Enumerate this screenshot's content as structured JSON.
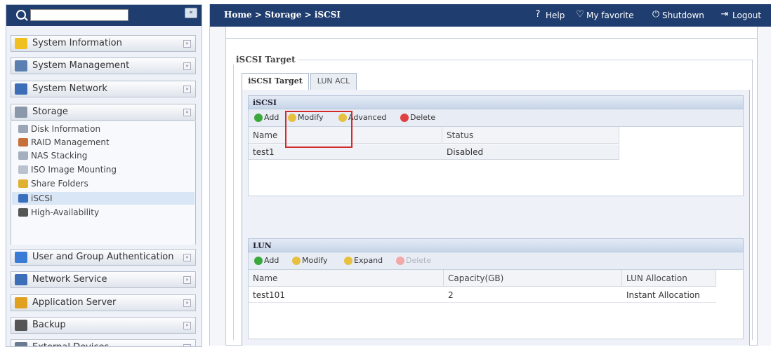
{
  "sidebar": {
    "search_placeholder": "",
    "collapse_glyph": "«",
    "categories": [
      {
        "label": "System Information",
        "icon": "info-icon",
        "color": "#f0c020"
      },
      {
        "label": "System Management",
        "icon": "tools-icon",
        "color": "#5a7fb0"
      },
      {
        "label": "System Network",
        "icon": "network-icon",
        "color": "#3c6fb8"
      },
      {
        "label": "Storage",
        "icon": "storage-icon",
        "color": "#8a98aa"
      },
      {
        "label": "User and Group Authentication",
        "icon": "users-icon",
        "color": "#3a7bd5"
      },
      {
        "label": "Network Service",
        "icon": "network-service-icon",
        "color": "#3c6fb8"
      },
      {
        "label": "Application Server",
        "icon": "app-server-icon",
        "color": "#e0a020"
      },
      {
        "label": "Backup",
        "icon": "backup-icon",
        "color": "#555555"
      },
      {
        "label": "External Devices",
        "icon": "external-devices-icon",
        "color": "#6b7a90"
      }
    ],
    "storage_items": [
      {
        "label": "Disk Information",
        "icon": "disk-icon",
        "color": "#9aa6b5"
      },
      {
        "label": "RAID Management",
        "icon": "raid-icon",
        "color": "#c8703a"
      },
      {
        "label": "NAS Stacking",
        "icon": "nas-stacking-icon",
        "color": "#a4b0bf"
      },
      {
        "label": "ISO Image Mounting",
        "icon": "iso-icon",
        "color": "#b9c2cd"
      },
      {
        "label": "Share Folders",
        "icon": "folder-icon",
        "color": "#e0b030"
      },
      {
        "label": "iSCSI",
        "icon": "iscsi-icon",
        "color": "#3a6fc0"
      },
      {
        "label": "High-Availability",
        "icon": "ha-icon",
        "color": "#555555"
      }
    ]
  },
  "topbar": {
    "breadcrumb": "Home > Storage > iSCSI",
    "help": "Help",
    "favorite": "My favorite",
    "shutdown": "Shutdown",
    "logout": "Logout"
  },
  "main": {
    "fieldset_title": "iSCSI Target",
    "tabs": [
      "iSCSI Target",
      "LUN ACL"
    ],
    "iscsi_section": {
      "title": "iSCSI",
      "toolbar": {
        "add": "Add",
        "modify": "Modify",
        "advanced": "Advanced",
        "delete": "Delete"
      },
      "columns": [
        "Name",
        "Status"
      ],
      "rows": [
        [
          "test1",
          "Disabled"
        ]
      ]
    },
    "lun_section": {
      "title": "LUN",
      "toolbar": {
        "add": "Add",
        "modify": "Modify",
        "expand": "Expand",
        "delete": "Delete"
      },
      "columns": [
        "Name",
        "Capacity(GB)",
        "LUN Allocation"
      ],
      "rows": [
        [
          "test101",
          "2",
          "Instant Allocation"
        ]
      ]
    }
  },
  "colors": {
    "header_bg": "#1f3d6e",
    "highlight": "#d42a2a",
    "add_green": "#3aa83a",
    "delete_red": "#e04040",
    "modify_yellow": "#e8c040"
  }
}
